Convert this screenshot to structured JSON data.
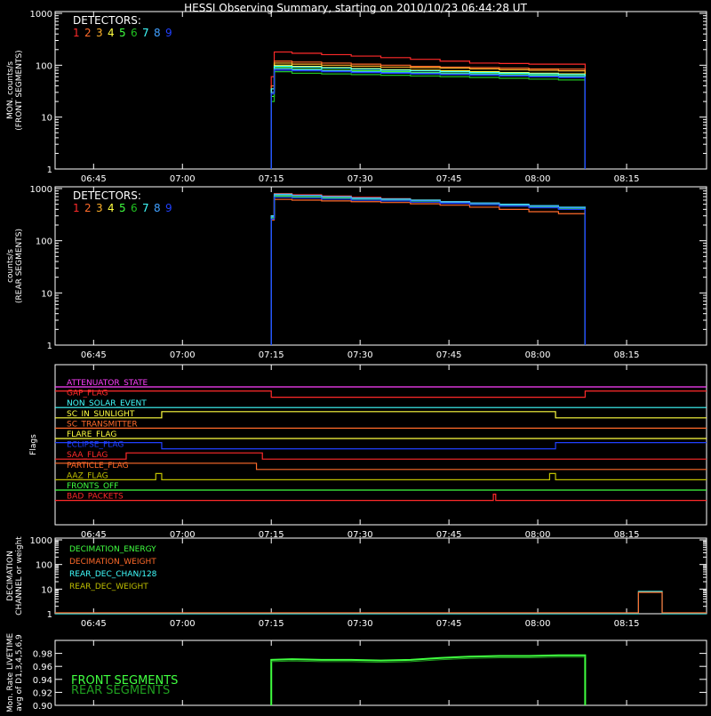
{
  "title": "HESSI Observing Summary, starting on 2010/10/23 06:44:28 UT",
  "time_ticks": [
    "06:45",
    "07:00",
    "07:15",
    "07:30",
    "07:45",
    "08:00",
    "08:15"
  ],
  "time_tick_minutes": [
    6.5,
    21.5,
    36.5,
    51.5,
    66.5,
    81.5,
    96.5
  ],
  "colors": {
    "axis": "#ffffff",
    "det": [
      "#ff2a2a",
      "#ff6a2a",
      "#ffb02a",
      "#ffff40",
      "#40ff40",
      "#20c020",
      "#40ffff",
      "#40a0ff",
      "#2040ff"
    ]
  },
  "chart_data": [
    {
      "type": "line",
      "ylabel": "MON. counts/s\n(FRONT SEGMENTS)",
      "yscale": "log",
      "ylim": [
        1,
        1000
      ],
      "yticks": [
        "1",
        "10",
        "100",
        "1000"
      ],
      "legend_title": "DETECTORS:",
      "legend_labels": [
        "1",
        "2",
        "3",
        "4",
        "5",
        "6",
        "7",
        "8",
        "9"
      ],
      "x_minutes": [
        36.5,
        37,
        40,
        45,
        50,
        55,
        60,
        65,
        70,
        75,
        80,
        85,
        89.5
      ],
      "series": [
        {
          "values": [
            60,
            180,
            170,
            160,
            150,
            140,
            130,
            120,
            110,
            108,
            105,
            105,
            100
          ]
        },
        {
          "values": [
            40,
            120,
            115,
            110,
            105,
            100,
            95,
            92,
            90,
            88,
            85,
            84,
            80
          ]
        },
        {
          "values": [
            35,
            110,
            105,
            100,
            96,
            92,
            90,
            88,
            85,
            82,
            80,
            78,
            75
          ]
        },
        {
          "values": [
            30,
            100,
            95,
            90,
            86,
            82,
            80,
            78,
            75,
            72,
            70,
            68,
            65
          ]
        },
        {
          "values": [
            25,
            90,
            85,
            80,
            78,
            75,
            72,
            70,
            68,
            66,
            64,
            62,
            60
          ]
        },
        {
          "values": [
            20,
            75,
            70,
            68,
            66,
            64,
            62,
            60,
            58,
            56,
            54,
            52,
            50
          ]
        },
        {
          "values": [
            35,
            95,
            92,
            88,
            84,
            80,
            78,
            75,
            72,
            70,
            68,
            66,
            64
          ]
        },
        {
          "values": [
            30,
            85,
            82,
            78,
            75,
            72,
            70,
            68,
            66,
            64,
            62,
            60,
            58
          ]
        },
        {
          "values": [
            28,
            80,
            78,
            75,
            72,
            70,
            68,
            66,
            64,
            62,
            60,
            58,
            55
          ]
        }
      ]
    },
    {
      "type": "line",
      "ylabel": "counts/s\n(REAR SEGMENTS)",
      "yscale": "log",
      "ylim": [
        1,
        1000
      ],
      "yticks": [
        "1",
        "10",
        "100",
        "1000"
      ],
      "legend_title": "DETECTORS:",
      "legend_labels": [
        "1",
        "2",
        "3",
        "4",
        "5",
        "6",
        "7",
        "8",
        "9"
      ],
      "x_minutes": [
        36.5,
        37,
        40,
        45,
        50,
        55,
        60,
        65,
        70,
        75,
        80,
        85,
        89.5
      ],
      "series": [
        {
          "values": [
            300,
            800,
            760,
            720,
            680,
            640,
            600,
            560,
            520,
            480,
            450,
            420,
            400
          ]
        },
        {
          "values": [
            250,
            620,
            600,
            580,
            560,
            540,
            510,
            480,
            440,
            400,
            360,
            330,
            300
          ]
        },
        {
          "values": [
            280,
            700,
            680,
            650,
            620,
            600,
            580,
            540,
            500,
            470,
            440,
            410,
            390
          ]
        },
        {
          "values": [
            280,
            720,
            690,
            660,
            630,
            610,
            580,
            550,
            510,
            480,
            450,
            420,
            400
          ]
        },
        {
          "values": [
            280,
            720,
            690,
            660,
            630,
            610,
            580,
            550,
            510,
            480,
            450,
            420,
            400
          ]
        },
        {
          "values": [
            270,
            700,
            680,
            650,
            620,
            600,
            570,
            540,
            500,
            470,
            440,
            410,
            390
          ]
        },
        {
          "values": [
            300,
            780,
            740,
            700,
            660,
            630,
            600,
            560,
            530,
            500,
            470,
            440,
            420
          ]
        },
        {
          "values": [
            290,
            760,
            730,
            690,
            650,
            620,
            590,
            550,
            520,
            490,
            460,
            430,
            410
          ]
        },
        {
          "values": [
            260,
            680,
            660,
            630,
            600,
            580,
            550,
            520,
            490,
            460,
            430,
            400,
            380
          ]
        }
      ]
    },
    {
      "type": "line",
      "ylabel": "Flags",
      "flags": [
        {
          "name": "ATTENUATOR_STATE",
          "color": "#ff40ff",
          "segments": [
            [
              0,
              110,
              0
            ]
          ]
        },
        {
          "name": "GAP_FLAG",
          "color": "#ff2a2a",
          "segments": [
            [
              0,
              36.5,
              1
            ],
            [
              36.5,
              89.5,
              0
            ],
            [
              89.5,
              110,
              1
            ]
          ]
        },
        {
          "name": "NON_SOLAR_EVENT",
          "color": "#40ffff",
          "segments": [
            [
              0,
              110,
              0
            ]
          ]
        },
        {
          "name": "SC_IN_SUNLIGHT",
          "color": "#ffff40",
          "segments": [
            [
              0,
              18,
              0
            ],
            [
              18,
              84.5,
              1
            ],
            [
              84.5,
              110,
              0
            ]
          ]
        },
        {
          "name": "SC_TRANSMITTER",
          "color": "#ff6a2a",
          "segments": [
            [
              0,
              110,
              0
            ]
          ]
        },
        {
          "name": "FLARE_FLAG",
          "color": "#ffff40",
          "segments": [
            [
              0,
              110,
              0
            ]
          ]
        },
        {
          "name": "ECLIPSE_FLAG",
          "color": "#2040ff",
          "segments": [
            [
              0,
              18,
              1
            ],
            [
              18,
              84.5,
              0
            ],
            [
              84.5,
              110,
              1
            ]
          ]
        },
        {
          "name": "SAA_FLAG",
          "color": "#ff2a2a",
          "segments": [
            [
              0,
              12,
              0
            ],
            [
              12,
              35,
              1
            ],
            [
              35,
              110,
              0
            ]
          ]
        },
        {
          "name": "PARTICLE_FLAG",
          "color": "#ff6a2a",
          "segments": [
            [
              0,
              34,
              1
            ],
            [
              34,
              110,
              0
            ]
          ]
        },
        {
          "name": "AAZ_FLAG",
          "color": "#c0c000",
          "segments": [
            [
              0,
              17,
              0
            ],
            [
              17,
              18,
              1
            ],
            [
              18,
              83.5,
              0
            ],
            [
              83.5,
              84.5,
              1
            ],
            [
              84.5,
              110,
              0
            ]
          ]
        },
        {
          "name": "FRONTS_OFF",
          "color": "#40ff40",
          "segments": [
            [
              0,
              110,
              0
            ]
          ]
        },
        {
          "name": "BAD_PACKETS",
          "color": "#ff2a2a",
          "segments": [
            [
              0,
              74,
              0
            ],
            [
              74,
              74.4,
              1
            ],
            [
              74.4,
              110,
              0
            ]
          ]
        }
      ]
    },
    {
      "type": "line",
      "ylabel": "DECIMATION\nCHANNEL or weight",
      "yscale": "log",
      "ylim": [
        1,
        1000
      ],
      "yticks": [
        "1",
        "10",
        "100",
        "1000"
      ],
      "legend": [
        {
          "name": "DECIMATION_ENERGY",
          "color": "#40ff40"
        },
        {
          "name": "DECIMATION_WEIGHT",
          "color": "#ff6a2a"
        },
        {
          "name": "REAR_DEC_CHAN/128",
          "color": "#40ffff"
        },
        {
          "name": "REAR_DEC_WEIGHT",
          "color": "#c0c000"
        }
      ],
      "rear_chan_x": [
        0,
        98.5,
        98.5,
        102.5,
        102.5,
        110
      ],
      "rear_chan_y": [
        1,
        1,
        8,
        8,
        1,
        1
      ]
    },
    {
      "type": "line",
      "ylabel": "Mon. Rate LIVETIME\navg of D1,3,4,5,6,9",
      "ylim": [
        0.9,
        1.0
      ],
      "yticks": [
        "0.90",
        "0.92",
        "0.94",
        "0.96",
        "0.98"
      ],
      "legend": [
        {
          "name": "FRONT SEGMENTS",
          "color": "#40ff40"
        },
        {
          "name": "REAR SEGMENTS",
          "color": "#20a020"
        }
      ],
      "x_minutes": [
        36.5,
        40,
        45,
        50,
        55,
        60,
        65,
        70,
        75,
        80,
        85,
        89.5
      ],
      "values": [
        0.97,
        0.971,
        0.97,
        0.97,
        0.969,
        0.97,
        0.973,
        0.975,
        0.976,
        0.976,
        0.977,
        0.977
      ]
    }
  ]
}
